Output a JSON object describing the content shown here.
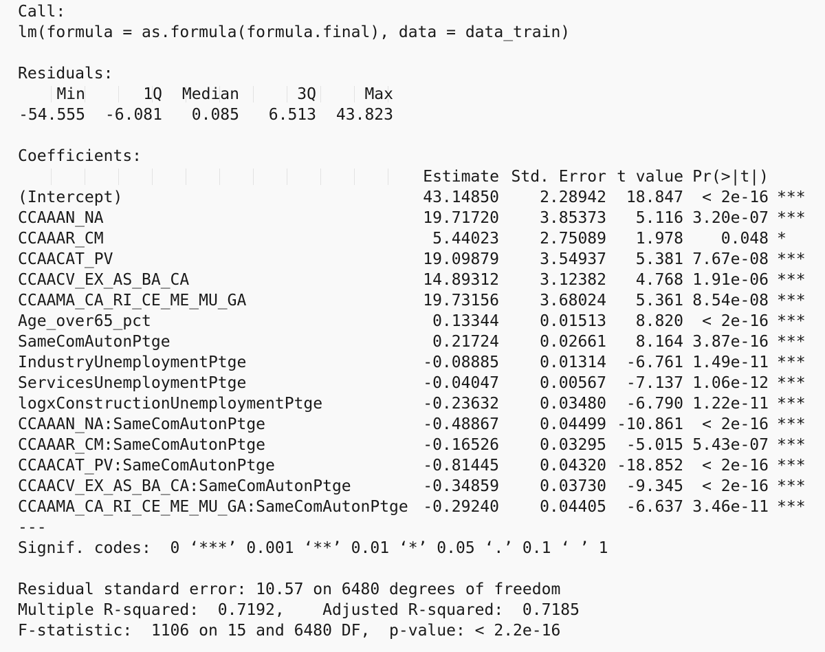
{
  "call": {
    "heading": "Call:",
    "formula": "lm(formula = as.formula(formula.final), data = data_train)"
  },
  "residuals": {
    "heading": "Residuals:",
    "labels": [
      "Min",
      "1Q",
      "Median",
      "3Q",
      "Max"
    ],
    "values": [
      "-54.555",
      "-6.081",
      "0.085",
      "6.513",
      "43.823"
    ]
  },
  "coefficients": {
    "heading": "Coefficients:",
    "columns": [
      "Estimate",
      "Std. Error",
      "t value",
      "Pr(>|t|)"
    ],
    "rows": [
      {
        "term": "(Intercept)",
        "estimate": "43.14850",
        "se": "2.28942",
        "t": "18.847",
        "p": "< 2e-16",
        "sig": "***"
      },
      {
        "term": "CCAAAN_NA",
        "estimate": "19.71720",
        "se": "3.85373",
        "t": "5.116",
        "p": "3.20e-07",
        "sig": "***"
      },
      {
        "term": "CCAAAR_CM",
        "estimate": "5.44023",
        "se": "2.75089",
        "t": "1.978",
        "p": "0.048",
        "sig": "*"
      },
      {
        "term": "CCAACAT_PV",
        "estimate": "19.09879",
        "se": "3.54937",
        "t": "5.381",
        "p": "7.67e-08",
        "sig": "***"
      },
      {
        "term": "CCAACV_EX_AS_BA_CA",
        "estimate": "14.89312",
        "se": "3.12382",
        "t": "4.768",
        "p": "1.91e-06",
        "sig": "***"
      },
      {
        "term": "CCAAMA_CA_RI_CE_ME_MU_GA",
        "estimate": "19.73156",
        "se": "3.68024",
        "t": "5.361",
        "p": "8.54e-08",
        "sig": "***"
      },
      {
        "term": "Age_over65_pct",
        "estimate": "0.13344",
        "se": "0.01513",
        "t": "8.820",
        "p": "< 2e-16",
        "sig": "***"
      },
      {
        "term": "SameComAutonPtge",
        "estimate": "0.21724",
        "se": "0.02661",
        "t": "8.164",
        "p": "3.87e-16",
        "sig": "***"
      },
      {
        "term": "IndustryUnemploymentPtge",
        "estimate": "-0.08885",
        "se": "0.01314",
        "t": "-6.761",
        "p": "1.49e-11",
        "sig": "***"
      },
      {
        "term": "ServicesUnemploymentPtge",
        "estimate": "-0.04047",
        "se": "0.00567",
        "t": "-7.137",
        "p": "1.06e-12",
        "sig": "***"
      },
      {
        "term": "logxConstructionUnemploymentPtge",
        "estimate": "-0.23632",
        "se": "0.03480",
        "t": "-6.790",
        "p": "1.22e-11",
        "sig": "***"
      },
      {
        "term": "CCAAAN_NA:SameComAutonPtge",
        "estimate": "-0.48867",
        "se": "0.04499",
        "t": "-10.861",
        "p": "< 2e-16",
        "sig": "***"
      },
      {
        "term": "CCAAAR_CM:SameComAutonPtge",
        "estimate": "-0.16526",
        "se": "0.03295",
        "t": "-5.015",
        "p": "5.43e-07",
        "sig": "***"
      },
      {
        "term": "CCAACAT_PV:SameComAutonPtge",
        "estimate": "-0.81445",
        "se": "0.04320",
        "t": "-18.852",
        "p": "< 2e-16",
        "sig": "***"
      },
      {
        "term": "CCAACV_EX_AS_BA_CA:SameComAutonPtge",
        "estimate": "-0.34859",
        "se": "0.03730",
        "t": "-9.345",
        "p": "< 2e-16",
        "sig": "***"
      },
      {
        "term": "CCAAMA_CA_RI_CE_ME_MU_GA:SameComAutonPtge",
        "estimate": "-0.29240",
        "se": "0.04405",
        "t": "-6.637",
        "p": "3.46e-11",
        "sig": "***"
      }
    ],
    "separator": "---",
    "signif_codes": "Signif. codes:  0 ‘***’ 0.001 ‘**’ 0.01 ‘*’ 0.05 ‘.’ 0.1 ‘ ’ 1"
  },
  "footer": {
    "rse": "Residual standard error: 10.57 on 6480 degrees of freedom",
    "rsq": "Multiple R-squared:  0.7192,    Adjusted R-squared:  0.7185",
    "fstat": "F-statistic:  1106 on 15 and 6480 DF,  p-value: < 2.2e-16"
  }
}
